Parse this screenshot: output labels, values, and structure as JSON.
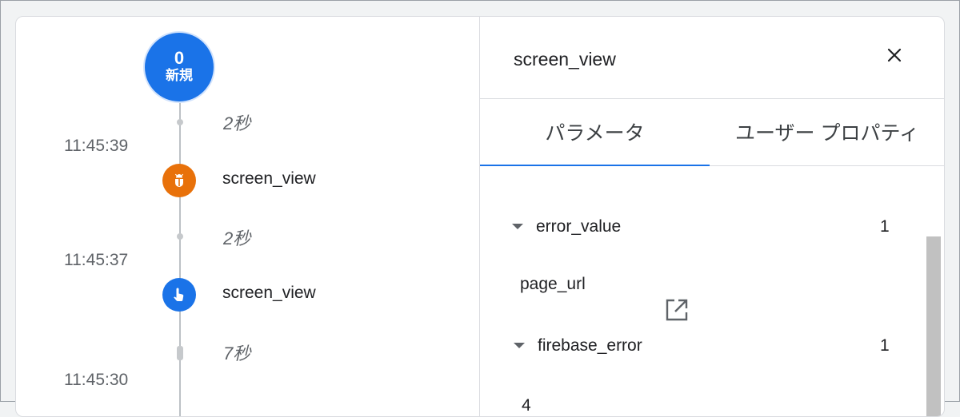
{
  "timeline": {
    "start": {
      "count": "0",
      "label": "新規"
    },
    "gaps": [
      "2秒",
      "2秒",
      "7秒"
    ],
    "timestamps": [
      "11:45:39",
      "11:45:37",
      "11:45:30"
    ],
    "events": [
      {
        "name": "screen_view",
        "icon": "bug-icon",
        "color": "#e8710a"
      },
      {
        "name": "screen_view",
        "icon": "touch-icon",
        "color": "#1a73e8"
      }
    ]
  },
  "panel": {
    "title": "screen_view",
    "tabs": [
      "パラメータ",
      "ユーザー プロパティ"
    ],
    "active_tab": "パラメータ",
    "params": [
      {
        "key": "error_value",
        "count": "1",
        "value": "page_url"
      },
      {
        "key": "firebase_error",
        "count": "1",
        "value": "4"
      }
    ]
  },
  "colors": {
    "accent": "#1a73e8",
    "event_orange": "#e8710a"
  }
}
